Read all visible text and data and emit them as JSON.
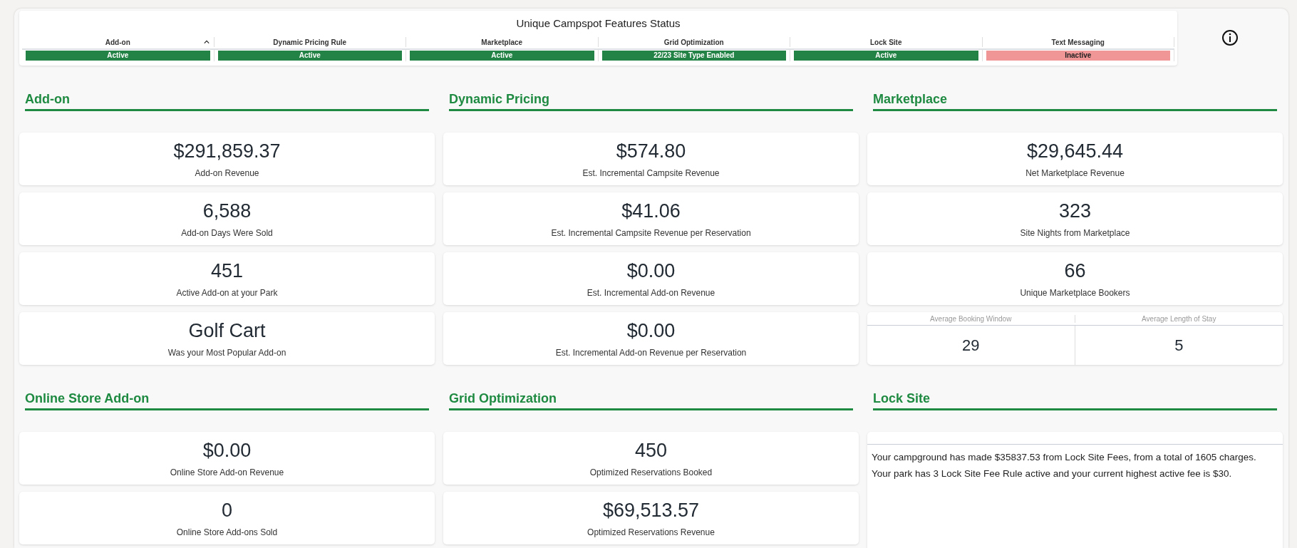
{
  "status_table": {
    "title": "Unique Campspot Features Status",
    "columns": [
      {
        "label": "Add-on",
        "sorted": true,
        "status": "Active",
        "active": true
      },
      {
        "label": "Dynamic Pricing Rule",
        "sorted": false,
        "status": "Active",
        "active": true
      },
      {
        "label": "Marketplace",
        "sorted": false,
        "status": "Active",
        "active": true
      },
      {
        "label": "Grid Optimization",
        "sorted": false,
        "status": "22/23 Site Type Enabled",
        "active": true
      },
      {
        "label": "Lock Site",
        "sorted": false,
        "status": "Active",
        "active": true
      },
      {
        "label": "Text Messaging",
        "sorted": false,
        "status": "Inactive",
        "active": false
      }
    ]
  },
  "sections": [
    {
      "title": "Add-on",
      "cards": [
        {
          "kind": "metric",
          "value": "$291,859.37",
          "label": "Add-on Revenue"
        },
        {
          "kind": "metric",
          "value": "6,588",
          "label": "Add-on Days Were Sold"
        },
        {
          "kind": "metric",
          "value": "451",
          "label": "Active Add-on at your Park"
        },
        {
          "kind": "metric",
          "value": "Golf Cart",
          "label": "Was your Most Popular Add-on"
        }
      ]
    },
    {
      "title": "Dynamic Pricing",
      "cards": [
        {
          "kind": "metric",
          "value": "$574.80",
          "label": "Est. Incremental Campsite Revenue"
        },
        {
          "kind": "metric",
          "value": "$41.06",
          "label": "Est. Incremental Campsite Revenue per Reservation"
        },
        {
          "kind": "metric",
          "value": "$0.00",
          "label": "Est. Incremental Add-on Revenue"
        },
        {
          "kind": "metric",
          "value": "$0.00",
          "label": "Est. Incremental Add-on Revenue per Reservation"
        }
      ]
    },
    {
      "title": "Marketplace",
      "cards": [
        {
          "kind": "metric",
          "value": "$29,645.44",
          "label": "Net Marketplace Revenue"
        },
        {
          "kind": "metric",
          "value": "323",
          "label": "Site Nights from Marketplace"
        },
        {
          "kind": "metric",
          "value": "66",
          "label": "Unique Marketplace Bookers"
        },
        {
          "kind": "split",
          "columns": [
            {
              "label": "Average Booking Window",
              "value": "29"
            },
            {
              "label": "Average Length of Stay",
              "value": "5"
            }
          ]
        }
      ]
    },
    {
      "title": "Online Store Add-on",
      "cards": [
        {
          "kind": "metric",
          "value": "$0.00",
          "label": "Online Store Add-on Revenue"
        },
        {
          "kind": "metric",
          "value": "0",
          "label": "Online Store Add-ons Sold"
        }
      ]
    },
    {
      "title": "Grid Optimization",
      "cards": [
        {
          "kind": "metric",
          "value": "450",
          "label": "Optimized Reservations Booked"
        },
        {
          "kind": "metric",
          "value": "$69,513.57",
          "label": "Optimized Reservations Revenue"
        }
      ]
    },
    {
      "title": "Lock Site",
      "cards": [
        {
          "kind": "text",
          "text": "Your campground has made $35837.53 from Lock Site Fees, from a total of 1605 charges. Your park has 3 Lock Site Fee Rule active and your current highest active fee is $30."
        }
      ]
    }
  ]
}
